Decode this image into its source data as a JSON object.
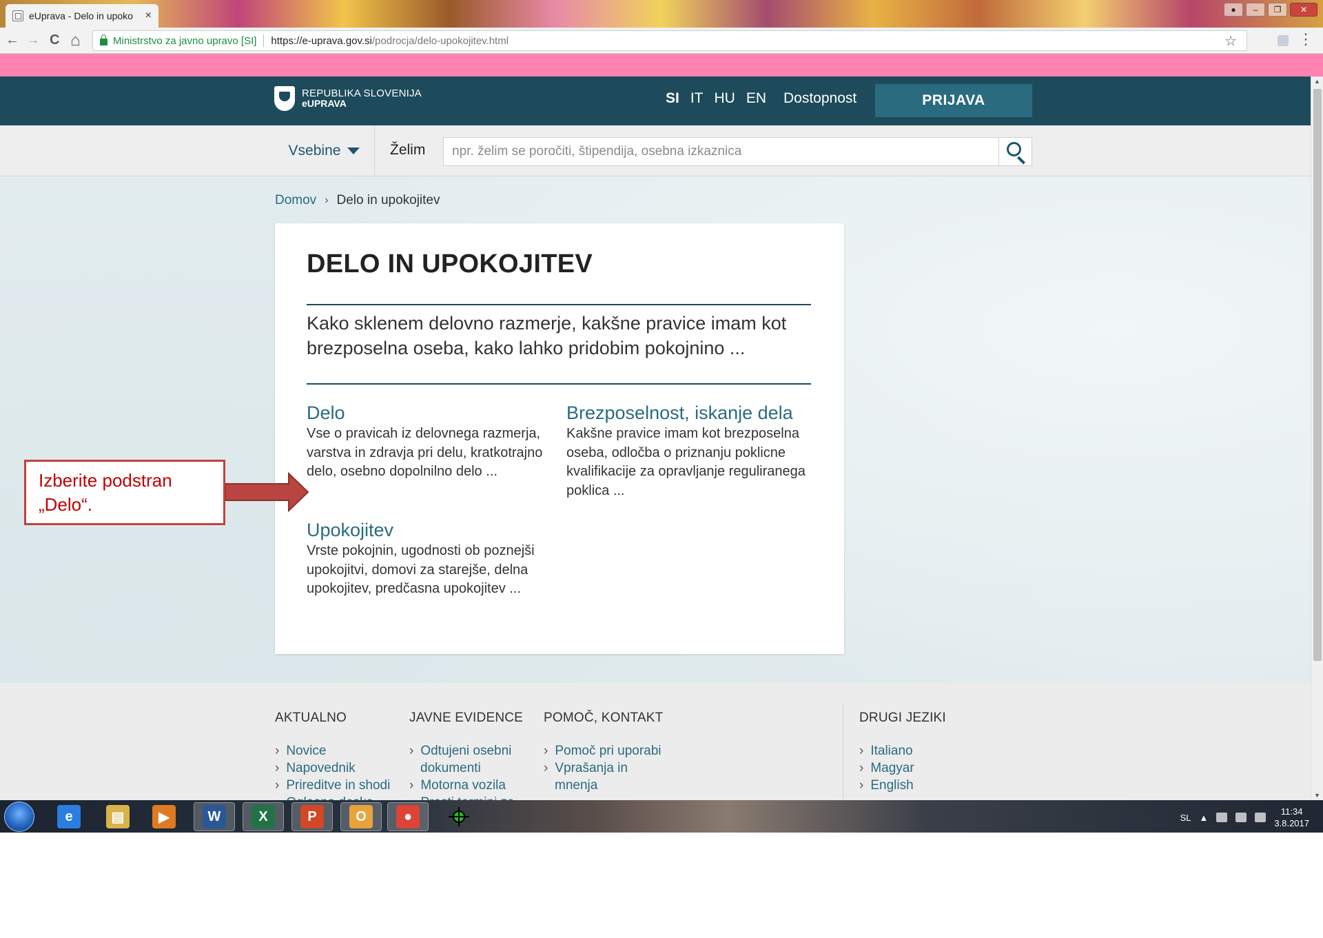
{
  "browser": {
    "tab_title": "eUprava - Delo in upoko",
    "tab_close": "×",
    "nav": {
      "back": "←",
      "forward": "→",
      "reload": "C",
      "home": "⌂"
    },
    "secure_label": "Ministrstvo za javno upravo [SI]",
    "url_host": "https://e-uprava.gov.si",
    "url_path": "/podrocja/delo-upokojitev.html",
    "star": "☆",
    "menu": "⋮"
  },
  "site": {
    "brand_top": "REPUBLIKA SLOVENIJA",
    "brand_bottom": "eUPRAVA",
    "languages": [
      "SI",
      "IT",
      "HU",
      "EN"
    ],
    "accessibility": "Dostopnost",
    "login": "PRIJAVA",
    "menu_label": "Vsebine",
    "want_label": "Želim",
    "search_placeholder": "npr. želim se poročiti, štipendija, osebna izkaznica"
  },
  "breadcrumb": {
    "home": "Domov",
    "separator": "›",
    "current": "Delo in upokojitev"
  },
  "card": {
    "title": "DELO IN UPOKOJITEV",
    "intro": "Kako sklenem delovno razmerje, kakšne pravice imam kot brezposelna oseba, kako lahko pridobim pokojnino ...",
    "sections": [
      {
        "title": "Delo",
        "desc": "Vse o pravicah iz delovnega razmerja, varstva in zdravja pri delu, kratkotrajno delo, osebno dopolnilno delo ..."
      },
      {
        "title": "Brezposelnost, iskanje dela",
        "desc": "Kakšne pravice imam kot brezposelna oseba, odločba o priznanju poklicne kvalifikacije za opravljanje reguliranega poklica ..."
      },
      {
        "title": "Upokojitev",
        "desc": "Vrste pokojnin, ugodnosti ob poznejši upokojitvi, domovi za starejše, delna upokojitev, predčasna upokojitev ..."
      }
    ]
  },
  "footer": {
    "bullet": "›",
    "col1": {
      "heading": "AKTUALNO",
      "links": [
        "Novice",
        "Napovednik",
        "Prireditve in shodi",
        "Oglasna deska"
      ]
    },
    "col2": {
      "heading": "JAVNE EVIDENCE",
      "link1": "Odtujeni osebni",
      "link1b": "dokumenti",
      "link2": "Motorna vozila",
      "link3": "Prosti termini za"
    },
    "col3": {
      "heading": "POMOČ, KONTAKT",
      "link1": "Pomoč pri uporabi",
      "link2": "Vprašanja in",
      "link2b": "mnenja"
    },
    "col4": {
      "heading": "DRUGI JEZIKI",
      "links": [
        "Italiano",
        "Magyar",
        "English"
      ]
    }
  },
  "annotation": {
    "text_line1": "Izberite podstran",
    "text_line2": "„Delo“."
  },
  "taskbar": {
    "apps": [
      {
        "name": "internet-explorer",
        "glyph": "e",
        "color": "#2b7de0"
      },
      {
        "name": "file-explorer",
        "glyph": "▤",
        "color": "#d9b24a"
      },
      {
        "name": "media-player",
        "glyph": "▶",
        "color": "#e07a22"
      },
      {
        "name": "word",
        "glyph": "W",
        "color": "#2b5797"
      },
      {
        "name": "excel",
        "glyph": "X",
        "color": "#217346"
      },
      {
        "name": "powerpoint",
        "glyph": "P",
        "color": "#d24726"
      },
      {
        "name": "outlook",
        "glyph": "O",
        "color": "#e8a33a"
      },
      {
        "name": "chrome",
        "glyph": "●",
        "color": "#db4437"
      }
    ],
    "lang": "SL",
    "tray_arrow": "▲",
    "time": "11:34",
    "date": "3.8.2017"
  },
  "colors": {
    "topnav": "#1d4b5b",
    "accent": "#2a6b80",
    "pink_bar": "#ff82b0",
    "annotation": "#c4403d"
  }
}
